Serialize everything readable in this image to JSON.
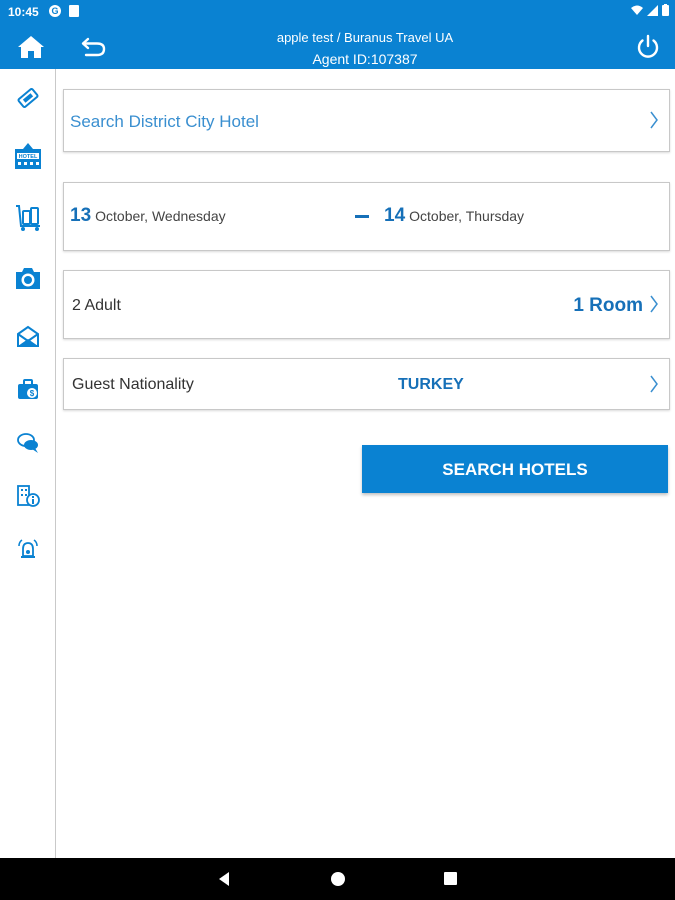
{
  "status_bar": {
    "time": "10:45"
  },
  "header": {
    "title": "apple test / Buranus Travel UA",
    "agent": "Agent ID:107387"
  },
  "sidebar": {
    "items": [
      {
        "icon": "ticket-icon"
      },
      {
        "icon": "hotel-icon"
      },
      {
        "icon": "luggage-cart-icon"
      },
      {
        "icon": "camera-icon"
      },
      {
        "icon": "envelope-icon"
      },
      {
        "icon": "briefcase-icon"
      },
      {
        "icon": "chat-icon"
      },
      {
        "icon": "building-info-icon"
      },
      {
        "icon": "alarm-icon"
      }
    ]
  },
  "form": {
    "search_placeholder": "Search District City Hotel",
    "checkin": {
      "day": "13",
      "text": "October, Wednesday"
    },
    "checkout": {
      "day": "14",
      "text": "October, Thursday"
    },
    "guests": "2 Adult",
    "rooms": "1 Room",
    "nationality_label": "Guest Nationality",
    "nationality_value": "TURKEY",
    "search_button": "SEARCH HOTELS"
  },
  "colors": {
    "primary": "#0a82d2",
    "accent_text": "#1670b8"
  }
}
